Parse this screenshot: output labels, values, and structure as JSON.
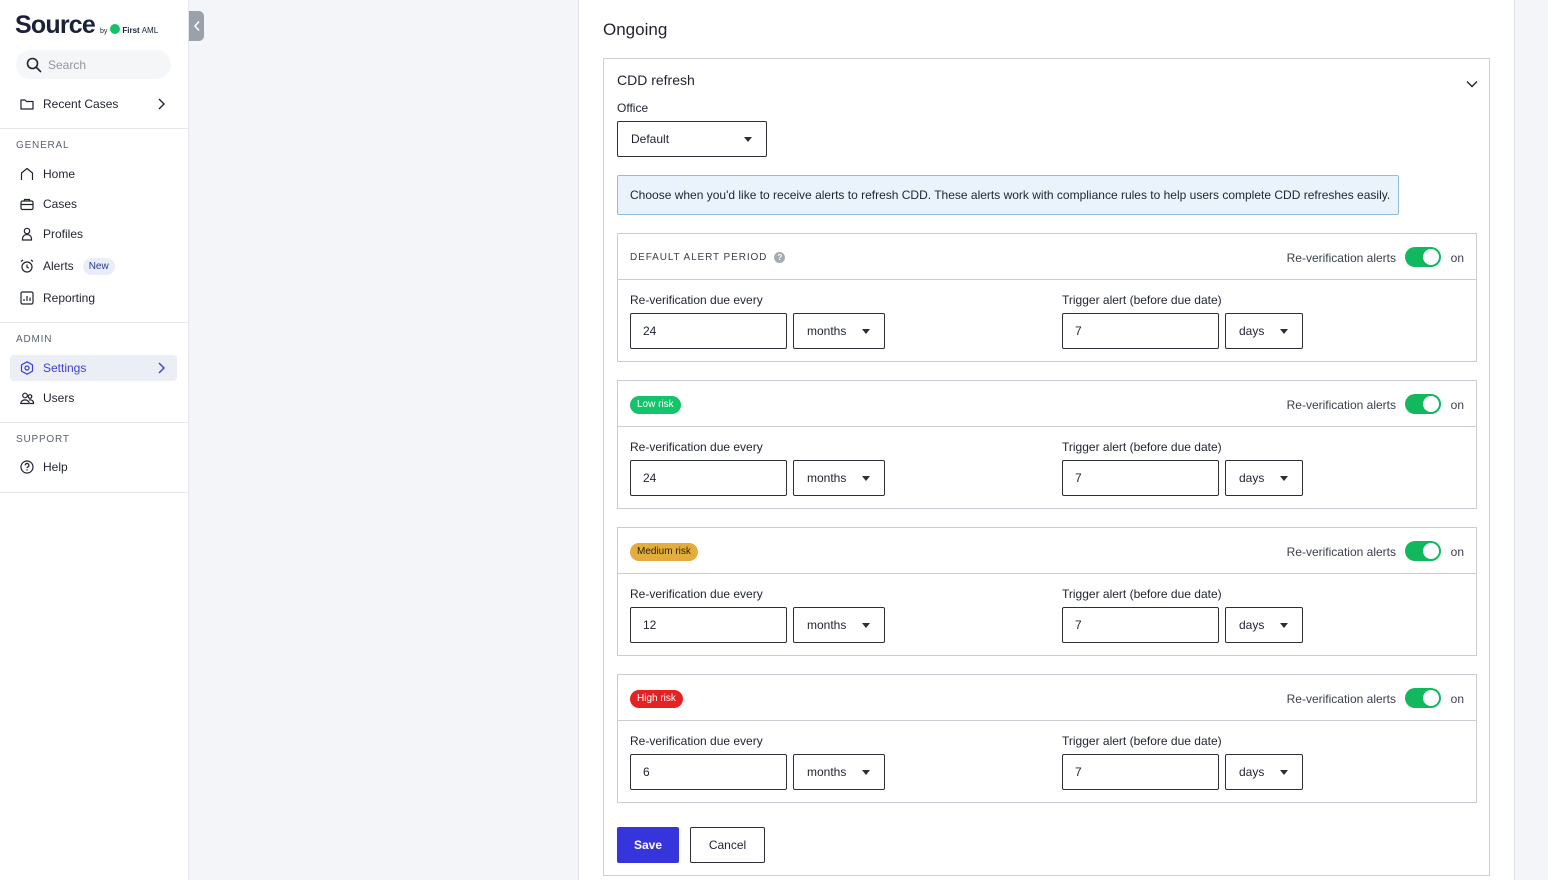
{
  "brand": {
    "name": "Source",
    "by": "by",
    "company_bold": "First",
    "company_rest": "AML"
  },
  "search": {
    "placeholder": "Search"
  },
  "recent_cases": "Recent Cases",
  "sections": {
    "general": "GENERAL",
    "admin": "ADMIN",
    "support": "SUPPORT"
  },
  "nav": {
    "home": "Home",
    "cases": "Cases",
    "profiles": "Profiles",
    "alerts": "Alerts",
    "alerts_badge": "New",
    "reporting": "Reporting",
    "settings": "Settings",
    "users": "Users",
    "help": "Help"
  },
  "main": {
    "title": "Ongoing",
    "accordion_title": "CDD refresh",
    "office_label": "Office",
    "office_value": "Default",
    "info": "Choose when you'd like to receive alerts to refresh CDD. These alerts work with compliance rules to help users complete CDD refreshes easily.",
    "save": "Save",
    "cancel": "Cancel"
  },
  "cards": [
    {
      "title": "DEFAULT ALERT PERIOD",
      "help": "?",
      "alerts_label": "Re-verification alerts",
      "alerts_enabled": true,
      "state": "on",
      "due_label": "Re-verification due every",
      "due_value": "24",
      "due_unit": "months",
      "trigger_label": "Trigger alert (before due date)",
      "trigger_value": "7",
      "trigger_unit": "days"
    },
    {
      "title": "Low risk",
      "color": "#13c46a",
      "alerts_label": "Re-verification alerts",
      "alerts_enabled": true,
      "state": "on",
      "due_label": "Re-verification due every",
      "due_value": "24",
      "due_unit": "months",
      "trigger_label": "Trigger alert (before due date)",
      "trigger_value": "7",
      "trigger_unit": "days"
    },
    {
      "title": "Medium risk",
      "color": "#e3ad3b",
      "alerts_label": "Re-verification alerts",
      "alerts_enabled": true,
      "state": "on",
      "due_label": "Re-verification due every",
      "due_value": "12",
      "due_unit": "months",
      "trigger_label": "Trigger alert (before due date)",
      "trigger_value": "7",
      "trigger_unit": "days"
    },
    {
      "title": "High risk",
      "color": "#e42222",
      "alerts_label": "Re-verification alerts",
      "alerts_enabled": true,
      "state": "on",
      "due_label": "Re-verification due every",
      "due_value": "6",
      "due_unit": "months",
      "trigger_label": "Trigger alert (before due date)",
      "trigger_value": "7",
      "trigger_unit": "days"
    }
  ],
  "colors": {
    "accent": "#3535db",
    "toggle_on": "#11b85e",
    "info_bg": "#eaf3fb"
  }
}
